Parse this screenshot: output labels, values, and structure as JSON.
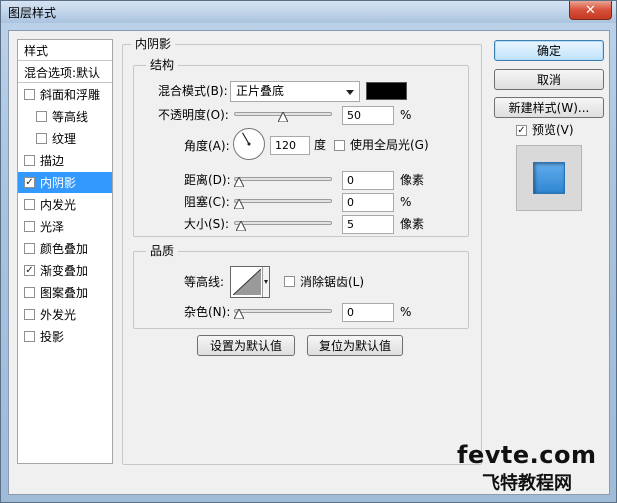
{
  "window": {
    "title": "图层样式",
    "close_glyph": "✕"
  },
  "styles": {
    "header": "样式",
    "blend_options": "混合选项:默认",
    "items": [
      {
        "label": "斜面和浮雕",
        "checked": false,
        "sub": false,
        "selected": false
      },
      {
        "label": "等高线",
        "checked": false,
        "sub": true,
        "selected": false
      },
      {
        "label": "纹理",
        "checked": false,
        "sub": true,
        "selected": false
      },
      {
        "label": "描边",
        "checked": false,
        "sub": false,
        "selected": false
      },
      {
        "label": "内阴影",
        "checked": true,
        "sub": false,
        "selected": true
      },
      {
        "label": "内发光",
        "checked": false,
        "sub": false,
        "selected": false
      },
      {
        "label": "光泽",
        "checked": false,
        "sub": false,
        "selected": false
      },
      {
        "label": "颜色叠加",
        "checked": false,
        "sub": false,
        "selected": false
      },
      {
        "label": "渐变叠加",
        "checked": true,
        "sub": false,
        "selected": false
      },
      {
        "label": "图案叠加",
        "checked": false,
        "sub": false,
        "selected": false
      },
      {
        "label": "外发光",
        "checked": false,
        "sub": false,
        "selected": false
      },
      {
        "label": "投影",
        "checked": false,
        "sub": false,
        "selected": false
      }
    ]
  },
  "inner_shadow": {
    "section_title": "内阴影",
    "structure": {
      "title": "结构",
      "blend_mode_label": "混合模式(B):",
      "blend_mode_value": "正片叠底",
      "shadow_color": "#000000",
      "opacity_label": "不透明度(O):",
      "opacity_value": "50",
      "opacity_fraction": 0.5,
      "percent": "%",
      "angle_label": "角度(A):",
      "angle_value": "120",
      "angle_unit": "度",
      "global_light_label": "使用全局光(G)",
      "global_light_checked": false,
      "distance_label": "距离(D):",
      "distance_value": "0",
      "distance_fraction": 0.0,
      "choke_label": "阻塞(C):",
      "choke_value": "0",
      "choke_fraction": 0.0,
      "size_label": "大小(S):",
      "size_value": "5",
      "size_fraction": 0.02,
      "pixel_unit": "像素"
    },
    "quality": {
      "title": "品质",
      "contour_label": "等高线:",
      "antialias_label": "消除锯齿(L)",
      "antialias_checked": false,
      "noise_label": "杂色(N):",
      "noise_value": "0",
      "noise_fraction": 0.0,
      "percent": "%"
    },
    "set_default_label": "设置为默认值",
    "reset_default_label": "复位为默认值"
  },
  "actions": {
    "ok_label": "确定",
    "cancel_label": "取消",
    "new_style_label": "新建样式(W)...",
    "preview_label": "预览(V)",
    "preview_checked": true
  },
  "watermark": {
    "line1": "fevte.com",
    "line2": "飞特教程网"
  },
  "colors": {
    "accent": "#3399ff",
    "preview_swatch": "#3a8fd6"
  }
}
